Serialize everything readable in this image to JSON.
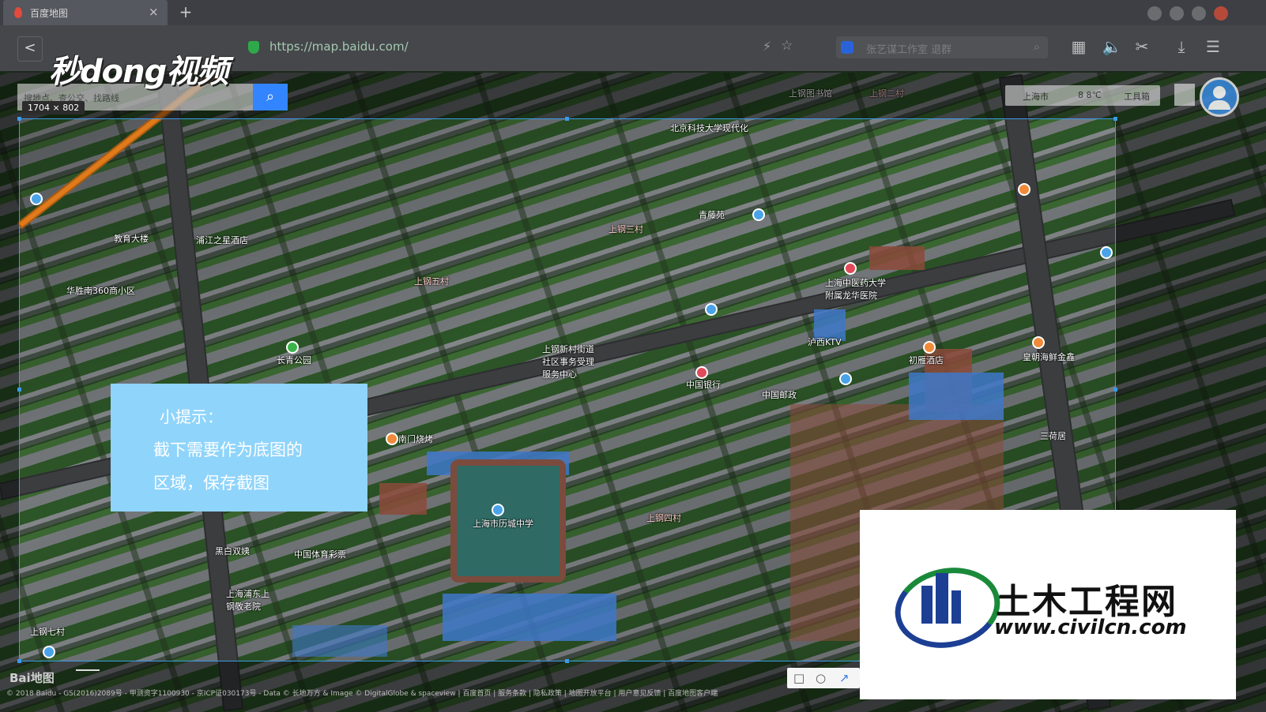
{
  "browser": {
    "tab_title": "百度地图",
    "tab_close": "×",
    "new_tab": "+",
    "back": "<",
    "url": "https://map.baidu.com/",
    "search_placeholder": "张艺谋工作室 退群",
    "icons": [
      "shield-secure-icon",
      "lightning-icon",
      "star-icon",
      "baidu-paw-icon",
      "search-icon",
      "apps-icon",
      "speaker-icon",
      "scissors-icon",
      "download-icon",
      "menu-icon"
    ]
  },
  "watermark_logo": "秒dong视频",
  "map": {
    "search_placeholder": "搜地点、查公交、找路线",
    "screenshot_size": "1704 × 802",
    "city_label": "上海市",
    "weather_label": "8 8℃",
    "tools_label": "工具箱",
    "labels": [
      {
        "text": "上钢三村",
        "red": true
      },
      {
        "text": "上钢五村",
        "red": true
      },
      {
        "text": "上钢四村",
        "red": true
      },
      {
        "text": "上钢七村",
        "red": false
      },
      {
        "text": "长青公园",
        "red": false
      },
      {
        "text": "中国银行",
        "red": false
      },
      {
        "text": "上海市历城中学",
        "red": false
      },
      {
        "text": "上海中医药大学附属龙华医院",
        "red": false
      },
      {
        "text": "浦江之星酒店",
        "red": false
      },
      {
        "text": "北京科技大学现代化",
        "red": false
      },
      {
        "text": "教育大楼",
        "red": false
      },
      {
        "text": "华胜南360商小区",
        "red": false
      },
      {
        "text": "泸西KTV",
        "red": false
      },
      {
        "text": "初雁酒店",
        "red": false
      },
      {
        "text": "皇朝海鲜金鑫",
        "red": false
      },
      {
        "text": "中国邮政",
        "red": false
      },
      {
        "text": "上钢新村街道社区事务受理服务中心",
        "red": false
      },
      {
        "text": "上钢图书馆",
        "red": false
      },
      {
        "text": "上钢二村",
        "red": true
      },
      {
        "text": "三荷居",
        "red": false
      },
      {
        "text": "青藤苑",
        "red": false
      },
      {
        "text": "上海浦东上钢敬老院",
        "red": false
      },
      {
        "text": "中国体育彩票",
        "red": false
      },
      {
        "text": "黑白双姨",
        "red": false
      },
      {
        "text": "南门烧烤",
        "red": false
      }
    ],
    "copyright": "© 2018 Baidu - GS(2016)2089号 - 甲测资字1100930 - 京ICP证030173号 - Data © 长地万方 & Image © DigitalGlobe & spaceview | 百度首页 | 服务条款 | 隐私政策 | 地图开放平台 | 用户意见反馈 | 百度地图客户端",
    "baidu_logo": "Bai地图"
  },
  "tip": {
    "title": "小提示：",
    "line1": "截下需要作为底图的",
    "line2": "区域，保存截图"
  },
  "snip_tools": [
    "square-tool-icon",
    "circle-tool-icon",
    "arrow-tool-icon"
  ],
  "civil": {
    "title": "土木工程网",
    "url": "www.civilcn.com"
  },
  "colors": {
    "tip_bg": "#8fd4fb",
    "selection": "#3a9be8",
    "baidu_blue": "#3385ff",
    "civil_blue": "#1c3f94",
    "civil_green": "#1a8a3a"
  }
}
